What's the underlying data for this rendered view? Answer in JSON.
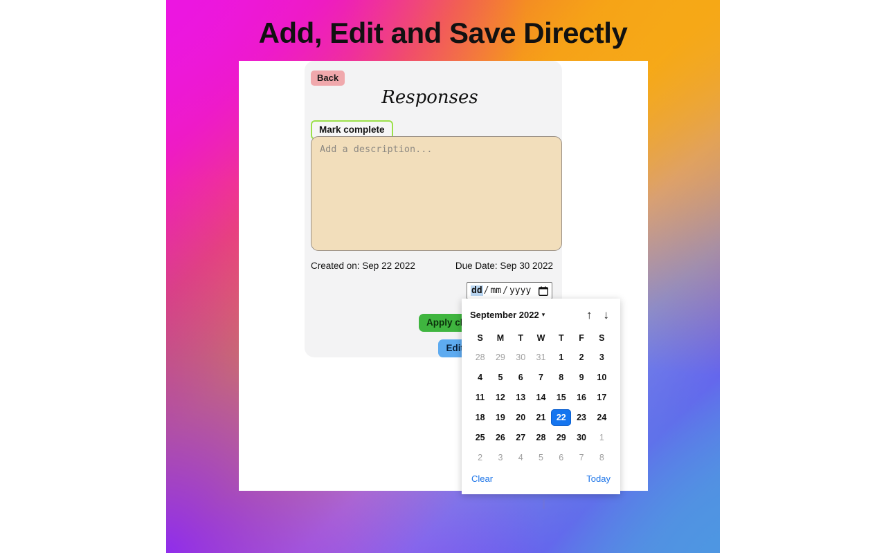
{
  "promo": {
    "title": "Add, Edit and Save Directly",
    "gradient": {
      "top_left": "#EC16E2",
      "top_right": "#F6A816",
      "bottom_left": "#8A26F7",
      "bottom_right": "#4E96E2"
    }
  },
  "card": {
    "back_label": "Back",
    "title": "Responses",
    "mark_complete_label": "Mark complete",
    "description_placeholder": "Add a description...",
    "description_value": "",
    "created_on": "Created on: Sep 22 2022",
    "due_date": "Due Date: Sep 30 2022",
    "apply_label": "Apply changes",
    "edit_label": "Edit other details",
    "colors": {
      "back": "#F0A8AC",
      "mark_complete_border": "#9BE04A",
      "apply": "#3FB53F",
      "edit": "#5EABF0",
      "description_bg": "#F2DEBB"
    }
  },
  "date_input": {
    "day_segment": "dd",
    "month_segment": "mm",
    "year_segment": "yyyy",
    "separator": "/",
    "icon": "calendar-icon",
    "active_segment": "dd"
  },
  "datepicker": {
    "month_label": "September 2022",
    "caret": "▾",
    "prev_icon": "↑",
    "next_icon": "↓",
    "day_headers": [
      "S",
      "M",
      "T",
      "W",
      "T",
      "F",
      "S"
    ],
    "weeks": [
      [
        {
          "d": "28",
          "muted": true
        },
        {
          "d": "29",
          "muted": true
        },
        {
          "d": "30",
          "muted": true
        },
        {
          "d": "31",
          "muted": true
        },
        {
          "d": "1"
        },
        {
          "d": "2"
        },
        {
          "d": "3"
        }
      ],
      [
        {
          "d": "4"
        },
        {
          "d": "5"
        },
        {
          "d": "6"
        },
        {
          "d": "7"
        },
        {
          "d": "8"
        },
        {
          "d": "9"
        },
        {
          "d": "10"
        }
      ],
      [
        {
          "d": "11"
        },
        {
          "d": "12"
        },
        {
          "d": "13"
        },
        {
          "d": "14"
        },
        {
          "d": "15"
        },
        {
          "d": "16"
        },
        {
          "d": "17"
        }
      ],
      [
        {
          "d": "18"
        },
        {
          "d": "19"
        },
        {
          "d": "20"
        },
        {
          "d": "21"
        },
        {
          "d": "22",
          "selected": true
        },
        {
          "d": "23"
        },
        {
          "d": "24"
        }
      ],
      [
        {
          "d": "25"
        },
        {
          "d": "26"
        },
        {
          "d": "27"
        },
        {
          "d": "28"
        },
        {
          "d": "29"
        },
        {
          "d": "30"
        },
        {
          "d": "1",
          "muted": true
        }
      ],
      [
        {
          "d": "2",
          "muted": true
        },
        {
          "d": "3",
          "muted": true
        },
        {
          "d": "4",
          "muted": true
        },
        {
          "d": "5",
          "muted": true
        },
        {
          "d": "6",
          "muted": true
        },
        {
          "d": "7",
          "muted": true
        },
        {
          "d": "8",
          "muted": true
        }
      ]
    ],
    "selected_day": "22",
    "clear_label": "Clear",
    "today_label": "Today",
    "link_color": "#1A73E8",
    "selected_color": "#1575EF"
  }
}
